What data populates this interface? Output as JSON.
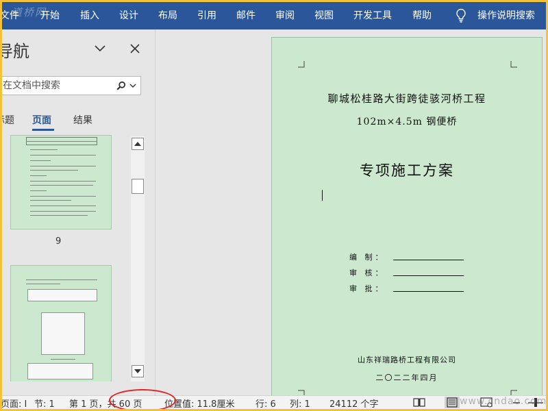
{
  "ribbon": {
    "watermark": "道桥网",
    "tabs": [
      {
        "label": "文件"
      },
      {
        "label": "开始"
      },
      {
        "label": "插入"
      },
      {
        "label": "设计"
      },
      {
        "label": "布局"
      },
      {
        "label": "引用"
      },
      {
        "label": "邮件"
      },
      {
        "label": "审阅"
      },
      {
        "label": "视图"
      },
      {
        "label": "开发工具"
      },
      {
        "label": "帮助"
      }
    ],
    "tell_me": "操作说明搜索",
    "bulb_icon": "lightbulb-icon"
  },
  "nav_pane": {
    "title": "导航",
    "search_placeholder": "在文档中搜索",
    "tabs": [
      {
        "label": "标题"
      },
      {
        "label": "页面"
      },
      {
        "label": "结果"
      }
    ],
    "thumbnail_page_number": "9"
  },
  "document": {
    "line1": "聊城松桂路大街跨徒骇河桥工程",
    "line2": "102m×4.5m 钢便桥",
    "heading": "专项施工方案",
    "signatures": [
      {
        "label": "编    制："
      },
      {
        "label": "审    核："
      },
      {
        "label": "审    批："
      }
    ],
    "company": "山东祥瑞路桥工程有限公司",
    "date": "二〇二二年四月"
  },
  "status_bar": {
    "section_page": "页面: I",
    "section": "节: 1",
    "page": "第 1 页，共 60 页",
    "position": "位置值: 11.8厘米",
    "line": "行: 6",
    "column": "列: 1",
    "word_count": "24112 个字",
    "watermark": "www.cndao.com"
  },
  "colors": {
    "ribbon": "#2b579a",
    "page_background": "#cce8cf",
    "annotation": "#e02424",
    "frame": "#f3c23a"
  }
}
